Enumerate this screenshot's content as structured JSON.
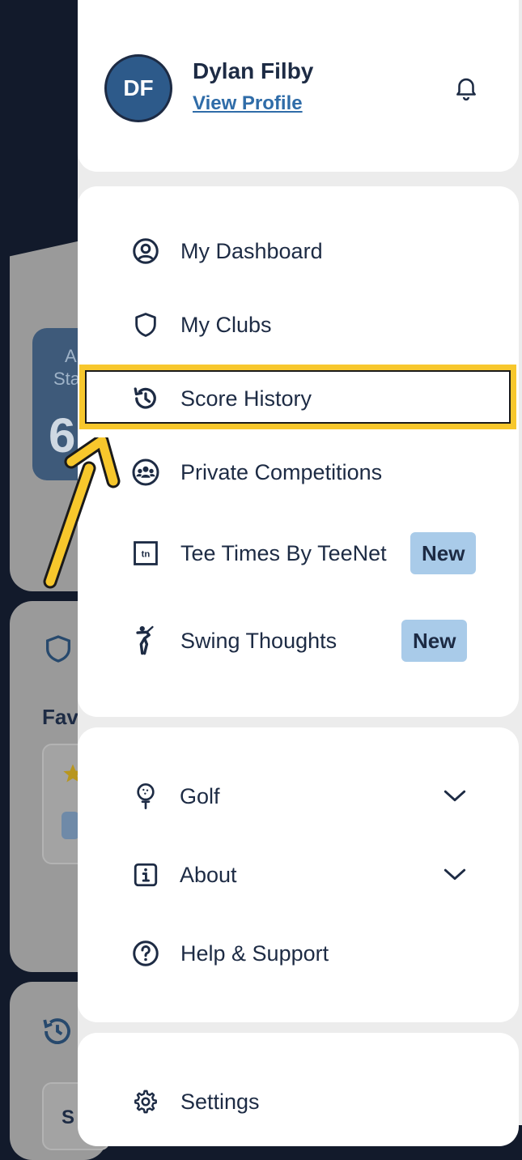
{
  "profile": {
    "initials": "DF",
    "name": "Dylan Filby",
    "view_profile": "View Profile"
  },
  "nav": {
    "items": [
      {
        "label": "My Dashboard",
        "icon": "user-circle-icon"
      },
      {
        "label": "My Clubs",
        "icon": "shield-icon"
      },
      {
        "label": "Score History",
        "icon": "history-icon"
      },
      {
        "label": "Private Competitions",
        "icon": "group-icon"
      },
      {
        "label": "Tee Times By TeeNet",
        "icon": "teenet-icon",
        "badge": "New"
      },
      {
        "label": "Swing Thoughts",
        "icon": "golfer-icon",
        "badge": "New"
      }
    ]
  },
  "more": {
    "items": [
      {
        "label": "Golf",
        "icon": "golf-ball-tee-icon",
        "expandable": true
      },
      {
        "label": "About",
        "icon": "info-icon",
        "expandable": true
      },
      {
        "label": "Help & Support",
        "icon": "question-icon"
      }
    ]
  },
  "settings": {
    "label": "Settings",
    "icon": "gear-icon"
  },
  "background": {
    "card_partial_text_1": "A",
    "card_partial_text_2": "Sta",
    "card_partial_number": "6",
    "favourites_partial": "Fav",
    "score_partial": "S"
  },
  "colors": {
    "navy": "#1d2b44",
    "link_blue": "#2f6ca8",
    "badge_blue": "#a9cbe9",
    "highlight_yellow": "#f7c72c"
  }
}
